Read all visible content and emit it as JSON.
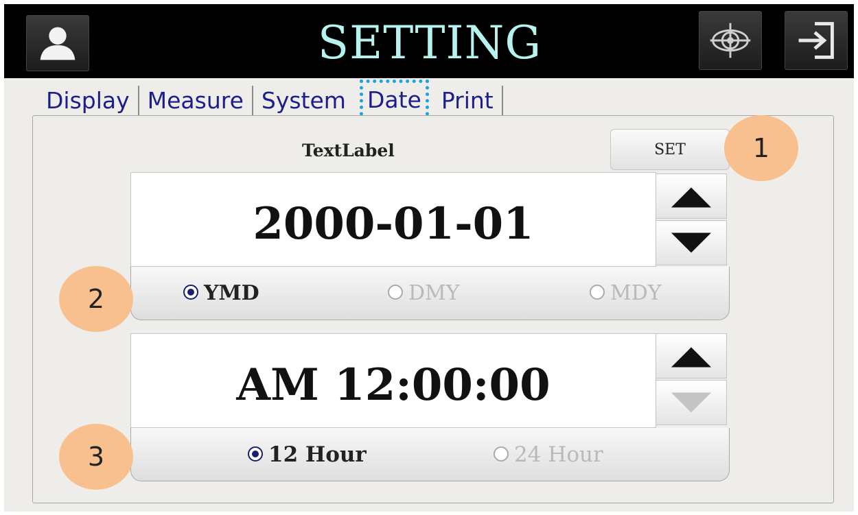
{
  "header": {
    "title": "SETTING",
    "left_icon": "user-icon",
    "right_icons": [
      "target-icon",
      "exit-icon"
    ]
  },
  "tabs": [
    {
      "label": "Display",
      "active": false
    },
    {
      "label": "Measure",
      "active": false
    },
    {
      "label": "System",
      "active": false
    },
    {
      "label": "Date",
      "active": true
    },
    {
      "label": "Print",
      "active": false
    }
  ],
  "panel": {
    "text_label": "TextLabel",
    "set_label": "SET",
    "date_value": "2000-01-01",
    "date_formats": [
      {
        "label": "YMD",
        "selected": true
      },
      {
        "label": "DMY",
        "selected": false
      },
      {
        "label": "MDY",
        "selected": false
      }
    ],
    "time_value": "AM 12:00:00",
    "time_formats": [
      {
        "label": "12 Hour",
        "selected": true
      },
      {
        "label": "24 Hour",
        "selected": false
      }
    ]
  },
  "callouts": [
    "1",
    "2",
    "3"
  ],
  "colors": {
    "title": "#b6f2ee",
    "tab_text": "#1c1f8a",
    "active_tab_outline": "#1ba3e0",
    "callout": "#f8c08f",
    "radio_selected": "#1a1f6e"
  }
}
